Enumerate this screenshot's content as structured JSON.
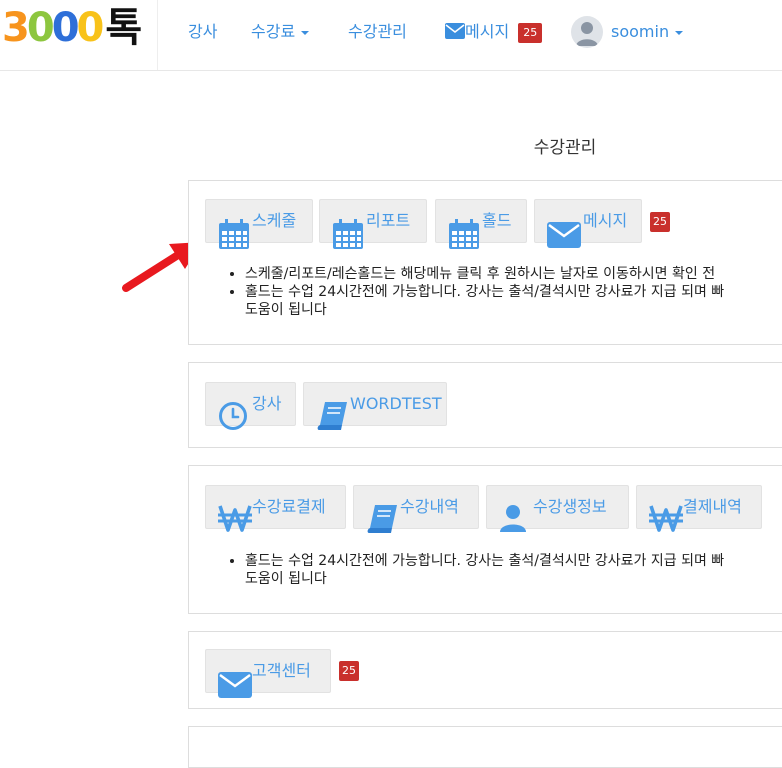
{
  "brand": {
    "d1": "3",
    "d2": "0",
    "d3": "0",
    "d4": "0",
    "suffix": "톡"
  },
  "nav": {
    "teacher": "강사",
    "fee": "수강료",
    "manage": "수강관리",
    "message": "메시지",
    "message_count": "25",
    "username": "soomin"
  },
  "page": {
    "title": "수강관리"
  },
  "panel1": {
    "buttons": [
      {
        "label": "스케줄",
        "icon": "calendar-icon"
      },
      {
        "label": "리포트",
        "icon": "calendar-icon"
      },
      {
        "label": "홀드",
        "icon": "calendar-icon"
      },
      {
        "label": "메시지",
        "icon": "envelope-icon"
      }
    ],
    "message_count": "25",
    "notes": [
      "스케줄/리포트/레슨홀드는 해당메뉴 클릭 후 원하시는 날자로 이동하시면 확인 전",
      "홀드는 수업 24시간전에 가능합니다. 강사는 출석/결석시만 강사료가 지급 되며 빠",
      "도움이 됩니다"
    ]
  },
  "panel2": {
    "buttons": [
      {
        "label": "강사",
        "icon": "clock-icon"
      },
      {
        "label": "WORDTEST",
        "icon": "book-icon"
      }
    ]
  },
  "panel3": {
    "buttons": [
      {
        "label": "수강료결제",
        "icon": "won-icon"
      },
      {
        "label": "수강내역",
        "icon": "book-icon"
      },
      {
        "label": "수강생정보",
        "icon": "user-icon"
      },
      {
        "label": "결제내역",
        "icon": "won-icon"
      }
    ],
    "notes": [
      "홀드는 수업 24시간전에 가능합니다. 강사는 출석/결석시만 강사료가 지급 되며 빠",
      "도움이 됩니다"
    ]
  },
  "panel4": {
    "buttons": [
      {
        "label": "고객센터",
        "icon": "envelope-icon"
      }
    ],
    "message_count": "25"
  },
  "colors": {
    "link": "#3a8ede",
    "icon": "#4a9be6",
    "badge": "#c9302c",
    "arrow": "#e8191f"
  }
}
